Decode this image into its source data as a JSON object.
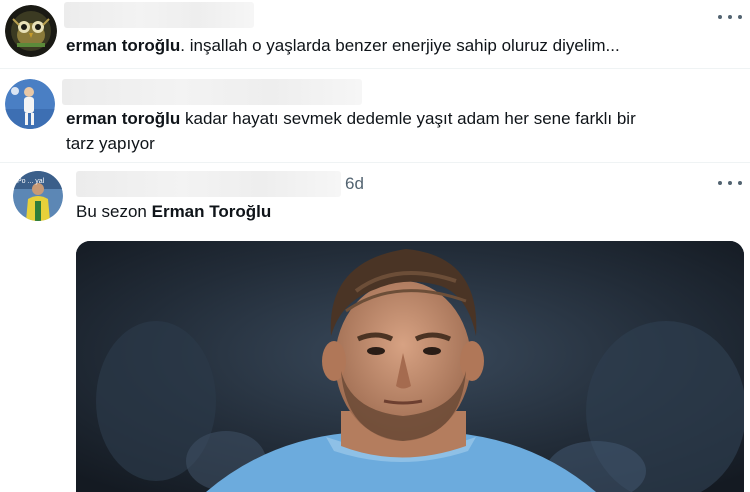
{
  "replies": [
    {
      "user_link": "erman toroğlu",
      "text": ". inşallah o yaşlarda benzer enerjiye sahip oluruz diyelim...",
      "avatar_icon": "owl-avatar-icon",
      "more_icon": "more-options-icon"
    },
    {
      "user_link": "erman toroğlu",
      "text": " kadar hayatı sevmek dedemle yaşıt adam her sene farklı bir",
      "text_line2": "tarz yapıyor",
      "avatar_icon": "runner-avatar-icon",
      "more_icon": "more-options-icon"
    },
    {
      "timestamp": "6d",
      "text_prefix": "Bu sezon ",
      "user_link": "Erman Toroğlu",
      "avatar_icon": "footballer-avatar-icon",
      "avatar_text": "Po ... yal",
      "more_icon": "more-options-icon",
      "media": "footballer-photo"
    }
  ],
  "colors": {
    "text": "#0f1419",
    "secondary": "#536471",
    "divider": "#eff3f4",
    "shirt": "#6cabdd"
  }
}
